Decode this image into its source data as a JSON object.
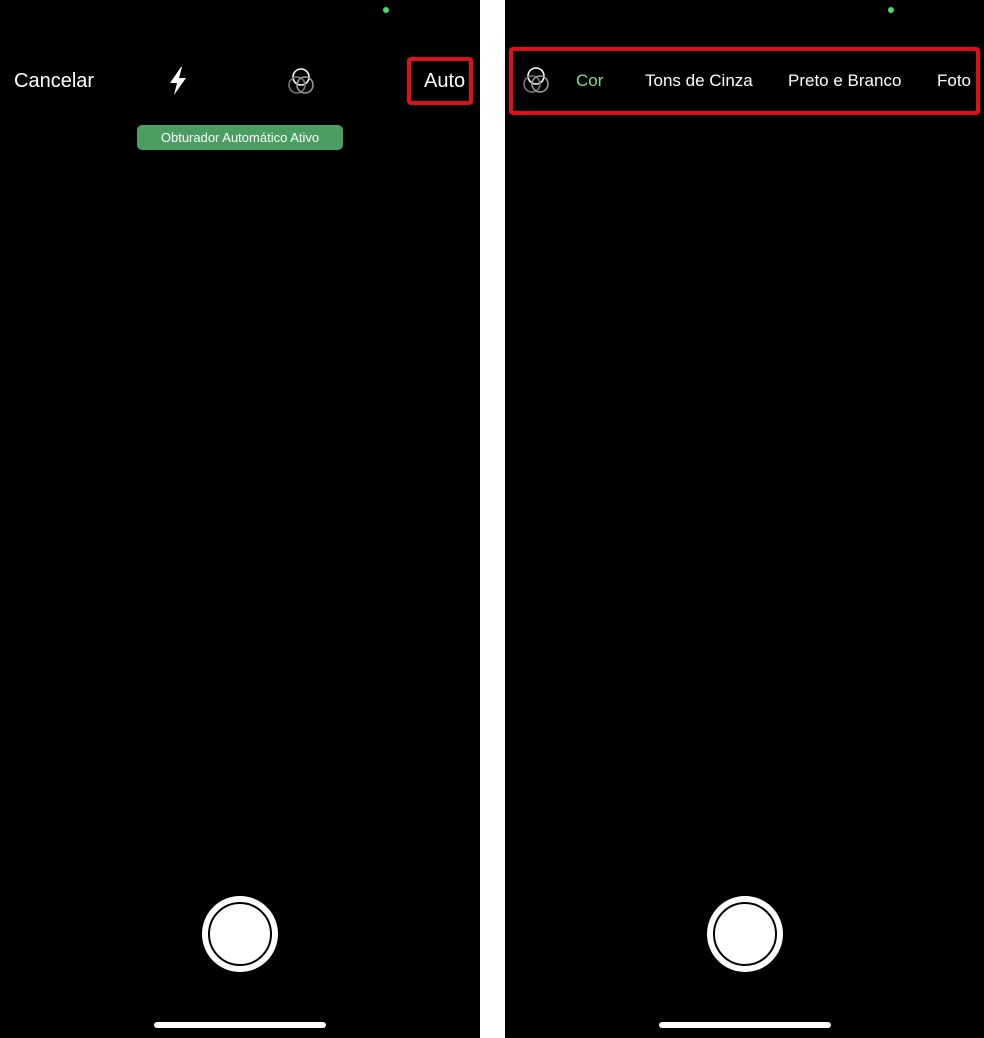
{
  "colors": {
    "accent_green": "#7fdc88",
    "toast_green": "#4b9e62",
    "highlight_red": "#e0101a",
    "background": "#000000"
  },
  "left_screen": {
    "cancel_label": "Cancelar",
    "flash_icon": "flash-icon",
    "filter_icon": "filter-circles-icon",
    "auto_label": "Auto",
    "toast": "Obturador Automático Ativo"
  },
  "right_screen": {
    "filter_icon": "filter-circles-icon",
    "selected_filter": "Cor",
    "filters": [
      {
        "label": "Cor"
      },
      {
        "label": "Tons de Cinza"
      },
      {
        "label": "Preto e Branco"
      },
      {
        "label": "Foto"
      }
    ]
  }
}
